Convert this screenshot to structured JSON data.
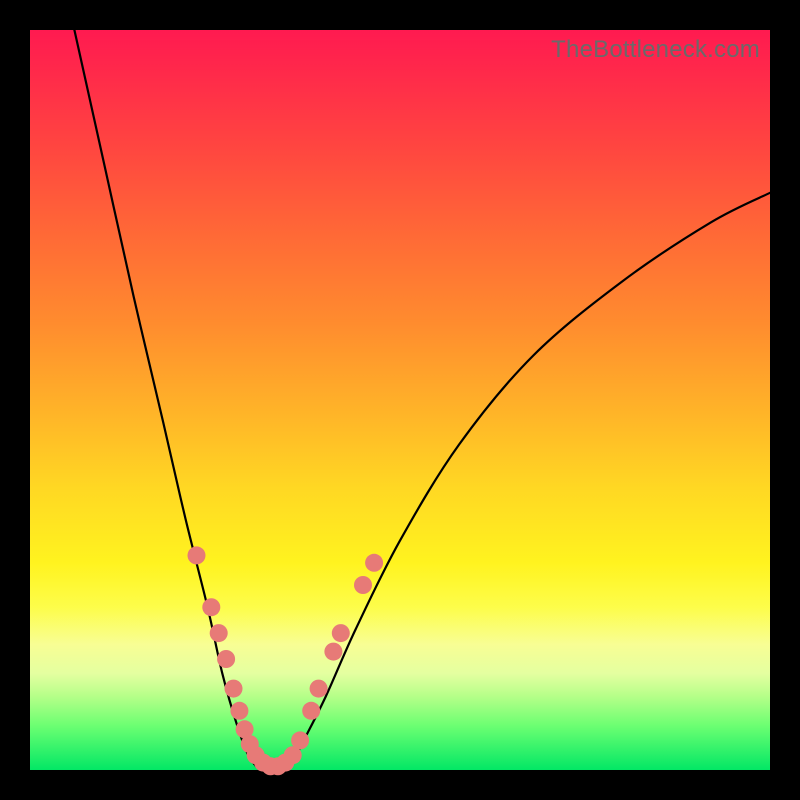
{
  "watermark": "TheBottleneck.com",
  "chart_data": {
    "type": "line",
    "title": "",
    "xlabel": "",
    "ylabel": "",
    "xlim": [
      0,
      100
    ],
    "ylim": [
      0,
      100
    ],
    "background_gradient": {
      "top_color": "#ff1a50",
      "mid_color": "#ffe022",
      "bottom_color": "#02e765"
    },
    "series": [
      {
        "name": "left-branch",
        "x": [
          6,
          10,
          14,
          18,
          21,
          24,
          26,
          28,
          29.5,
          31
        ],
        "values": [
          100,
          82,
          64,
          47,
          34,
          22,
          13,
          6,
          2,
          0
        ]
      },
      {
        "name": "valley",
        "x": [
          31,
          33,
          35
        ],
        "values": [
          0,
          0,
          0
        ]
      },
      {
        "name": "right-branch",
        "x": [
          35,
          37,
          40,
          44,
          50,
          58,
          68,
          80,
          92,
          100
        ],
        "values": [
          0,
          4,
          10,
          19,
          31,
          44,
          56,
          66,
          74,
          78
        ]
      }
    ],
    "scatter_points": {
      "name": "highlight-dots",
      "color": "#e77a77",
      "points": [
        {
          "x": 22.5,
          "y": 29
        },
        {
          "x": 24.5,
          "y": 22
        },
        {
          "x": 25.5,
          "y": 18.5
        },
        {
          "x": 26.5,
          "y": 15
        },
        {
          "x": 27.5,
          "y": 11
        },
        {
          "x": 28.3,
          "y": 8
        },
        {
          "x": 29.0,
          "y": 5.5
        },
        {
          "x": 29.7,
          "y": 3.5
        },
        {
          "x": 30.5,
          "y": 2
        },
        {
          "x": 31.5,
          "y": 1
        },
        {
          "x": 32.5,
          "y": 0.5
        },
        {
          "x": 33.5,
          "y": 0.5
        },
        {
          "x": 34.5,
          "y": 1
        },
        {
          "x": 35.5,
          "y": 2
        },
        {
          "x": 36.5,
          "y": 4
        },
        {
          "x": 38.0,
          "y": 8
        },
        {
          "x": 39.0,
          "y": 11
        },
        {
          "x": 41.0,
          "y": 16
        },
        {
          "x": 42.0,
          "y": 18.5
        },
        {
          "x": 45.0,
          "y": 25
        },
        {
          "x": 46.5,
          "y": 28
        }
      ]
    }
  }
}
